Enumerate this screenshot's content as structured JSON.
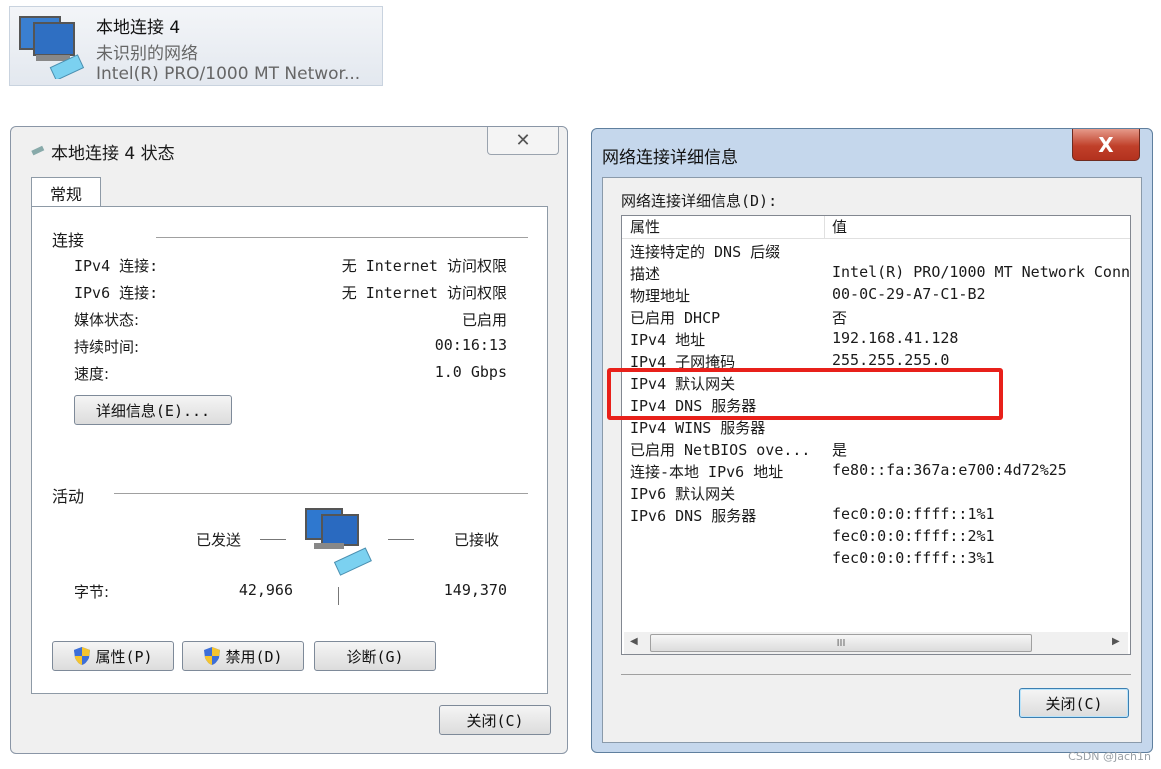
{
  "adapter_tile": {
    "name": "本地连接 4",
    "network": "未识别的网络",
    "device": "Intel(R) PRO/1000 MT Networ..."
  },
  "status_window": {
    "title": "本地连接 4 状态",
    "close_glyph": "✕",
    "tab_general": "常规",
    "connection": {
      "heading": "连接",
      "rows": [
        {
          "label": "IPv4 连接:",
          "value": "无 Internet 访问权限"
        },
        {
          "label": "IPv6 连接:",
          "value": "无 Internet 访问权限"
        },
        {
          "label": "媒体状态:",
          "value": "已启用"
        },
        {
          "label": "持续时间:",
          "value": "00:16:13"
        },
        {
          "label": "速度:",
          "value": "1.0 Gbps"
        }
      ],
      "details_button": "详细信息(E)..."
    },
    "activity": {
      "heading": "活动",
      "sent_label": "已发送",
      "received_label": "已接收",
      "bytes_label": "字节:",
      "bytes_sent": "42,966",
      "bytes_received": "149,370"
    },
    "buttons": {
      "properties": "属性(P)",
      "disable": "禁用(D)",
      "diagnose": "诊断(G)",
      "close": "关闭(C)"
    }
  },
  "details_window": {
    "title": "网络连接详细信息",
    "close_glyph": "X",
    "list_label": "网络连接详细信息(D):",
    "columns": {
      "property": "属性",
      "value": "值"
    },
    "rows": [
      {
        "property": "连接特定的 DNS 后缀",
        "value": ""
      },
      {
        "property": "描述",
        "value": "Intel(R) PRO/1000 MT Network Conn"
      },
      {
        "property": "物理地址",
        "value": "00-0C-29-A7-C1-B2"
      },
      {
        "property": "已启用 DHCP",
        "value": "否"
      },
      {
        "property": "IPv4 地址",
        "value": "192.168.41.128"
      },
      {
        "property": "IPv4 子网掩码",
        "value": "255.255.255.0"
      },
      {
        "property": "IPv4 默认网关",
        "value": ""
      },
      {
        "property": "IPv4 DNS 服务器",
        "value": ""
      },
      {
        "property": "IPv4 WINS 服务器",
        "value": ""
      },
      {
        "property": "已启用 NetBIOS ove...",
        "value": "是"
      },
      {
        "property": "连接-本地 IPv6 地址",
        "value": "fe80::fa:367a:e700:4d72%25"
      },
      {
        "property": "IPv6 默认网关",
        "value": ""
      },
      {
        "property": "IPv6 DNS 服务器",
        "value": "fec0:0:0:ffff::1%1"
      },
      {
        "property": "",
        "value": "fec0:0:0:ffff::2%1"
      },
      {
        "property": "",
        "value": "fec0:0:0:ffff::3%1"
      }
    ],
    "scroll_thumb": "III",
    "close_button": "关闭(C)",
    "highlight_color": "#e8201a"
  },
  "watermark": "CSDN @Jach1n"
}
